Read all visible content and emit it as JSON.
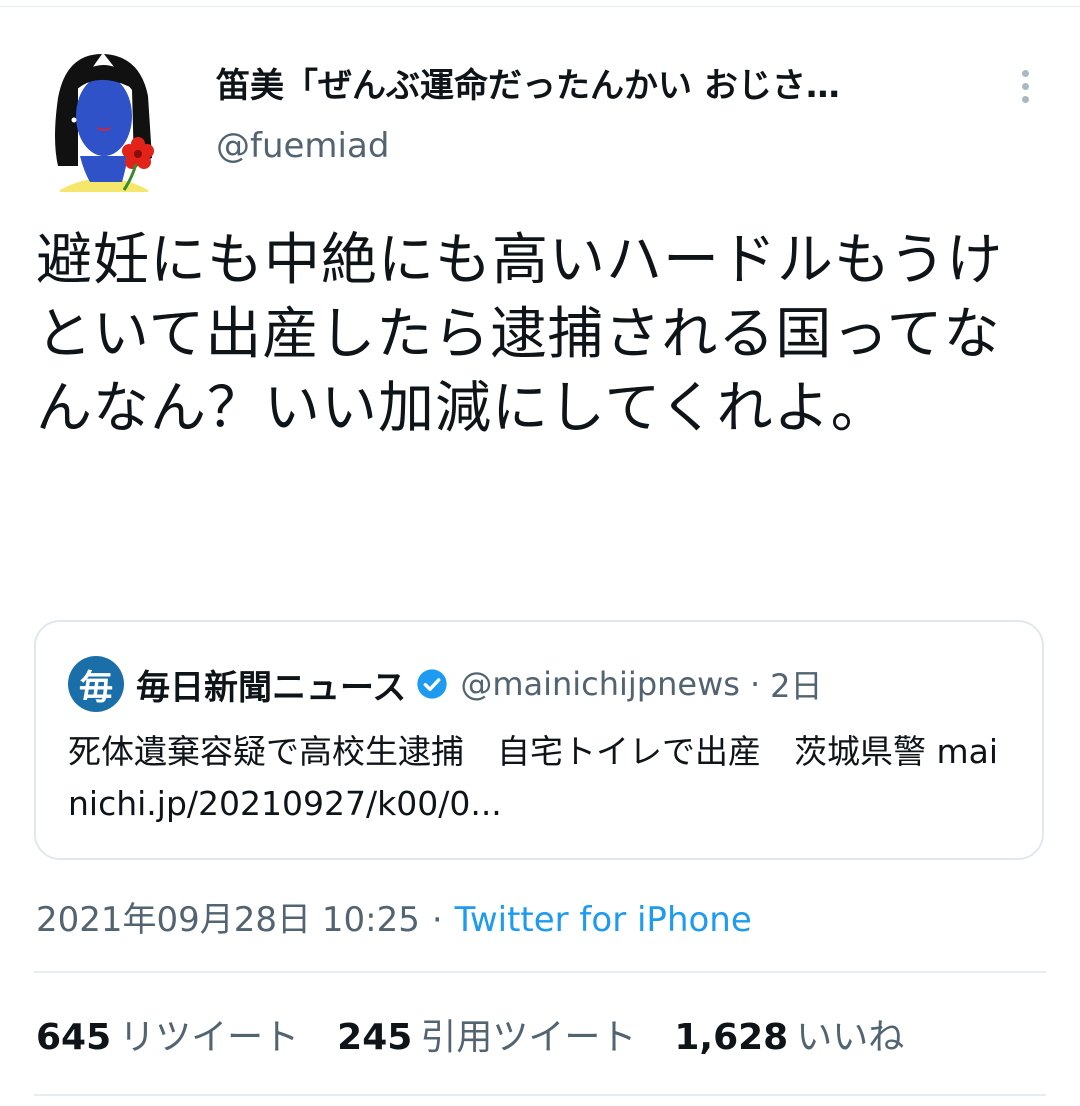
{
  "author": {
    "display_name": "笛美「ぜんぶ運命だったんかい おじさ…",
    "handle": "@fuemiad",
    "avatar_icon": "user-avatar-illustration"
  },
  "tweet": {
    "text": "避妊にも中絶にも高いハードルもうけといて出産したら逮捕される国ってなんなん？いい加減にしてくれよ。"
  },
  "quote": {
    "avatar_glyph": "毎",
    "name": "毎日新聞ニュース",
    "handle": "@mainichijpnews",
    "separator": "·",
    "age": "2日",
    "text": "死体遺棄容疑で高校生逮捕　自宅トイレで出産　茨城県警 mainichi.jp/20210927/k00/0..."
  },
  "meta": {
    "date": "2021年09月28日 10:25",
    "separator": "·",
    "source": "Twitter for iPhone"
  },
  "stats": {
    "retweets": {
      "count": "645",
      "label": "リツイート"
    },
    "quotes": {
      "count": "245",
      "label": "引用ツイート"
    },
    "likes": {
      "count": "1,628",
      "label": "いいね"
    }
  },
  "colors": {
    "link": "#1d9bf0",
    "secondary_text": "#536471",
    "verified": "#1d9bf0"
  }
}
